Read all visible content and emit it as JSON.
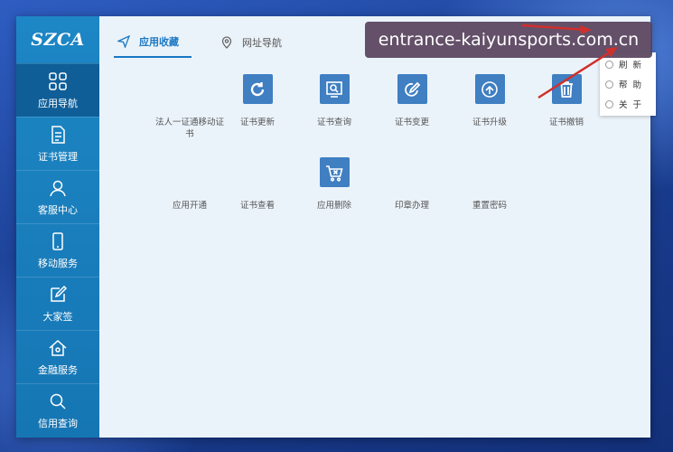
{
  "app": {
    "logo_text": "SZCA",
    "colors": {
      "sidebar": "#1676b4",
      "accent": "#1977c3",
      "tile": "#3f7fc2"
    }
  },
  "sidebar": {
    "items": [
      {
        "label": "应用导航",
        "icon": "grid-icon",
        "active": true
      },
      {
        "label": "证书管理",
        "icon": "document-icon",
        "active": false
      },
      {
        "label": "客服中心",
        "icon": "user-icon",
        "active": false
      },
      {
        "label": "移动服务",
        "icon": "mobile-icon",
        "active": false
      },
      {
        "label": "大家签",
        "icon": "edit-icon",
        "active": false
      },
      {
        "label": "金融服务",
        "icon": "home-icon",
        "active": false
      },
      {
        "label": "信用查询",
        "icon": "search-icon",
        "active": false
      }
    ]
  },
  "tabs": [
    {
      "label": "应用收藏",
      "icon": "send-icon",
      "active": true
    },
    {
      "label": "网址导航",
      "icon": "location-icon",
      "active": false
    }
  ],
  "apps": [
    {
      "label": "法人一证通移动证书",
      "icon": "none"
    },
    {
      "label": "证书更新",
      "icon": "refresh-icon"
    },
    {
      "label": "证书查询",
      "icon": "search-icon"
    },
    {
      "label": "证书变更",
      "icon": "edit-circle-icon"
    },
    {
      "label": "证书升级",
      "icon": "upgrade-icon"
    },
    {
      "label": "证书撤销",
      "icon": "trash-icon"
    },
    {
      "label": "应用开通",
      "icon": "none"
    },
    {
      "label": "证书查看",
      "icon": "none"
    },
    {
      "label": "应用删除",
      "icon": "cart-delete-icon"
    },
    {
      "label": "印章办理",
      "icon": "none"
    },
    {
      "label": "重置密码",
      "icon": "none"
    }
  ],
  "context_menu": {
    "items": [
      {
        "label": "刷新"
      },
      {
        "label": "帮助"
      },
      {
        "label": "关于"
      }
    ]
  },
  "watermark": {
    "text": "entrance-kaiyunsports.com.cn"
  }
}
